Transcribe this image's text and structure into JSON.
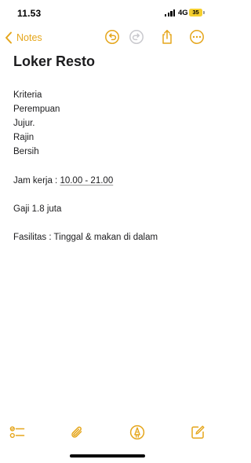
{
  "status_bar": {
    "time": "11.53",
    "network": "4G",
    "battery_level": "35",
    "battery_color": "#f5cf2e"
  },
  "nav": {
    "back_label": "Notes",
    "accent_color": "#e5a61c",
    "icons": [
      "chevron-left-icon",
      "undo-icon",
      "redo-icon",
      "share-icon",
      "more-icon"
    ]
  },
  "note": {
    "title": "Loker Resto",
    "lines": {
      "l1": "Kriteria",
      "l2": "Perempuan",
      "l3": "Jujur.",
      "l4": "Rajin",
      "l5": "Bersih",
      "jam_label": "Jam kerja : ",
      "jam_value": "10.00 - 21.00",
      "gaji": "Gaji  1.8 juta",
      "fasilitas": "Fasilitas : Tinggal & makan di dalam"
    }
  },
  "toolbar": {
    "icons": [
      "checklist-icon",
      "paperclip-icon",
      "markup-pen-icon",
      "compose-icon"
    ]
  }
}
